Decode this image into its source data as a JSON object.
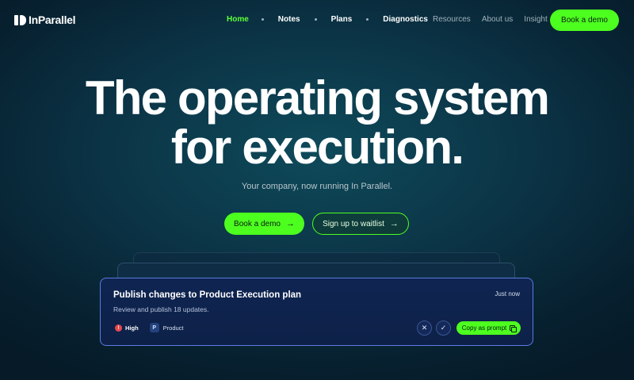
{
  "brand": {
    "name": "InParallel"
  },
  "nav": {
    "links": [
      "Home",
      "Notes",
      "Plans",
      "Diagnostics"
    ],
    "active": "Home",
    "secondary": [
      "Resources",
      "About us",
      "Insight"
    ],
    "cta_label": "Book a demo"
  },
  "hero": {
    "title_line1": "The operating system",
    "title_line2": "for execution.",
    "subtitle": "Your company, now running In Parallel.",
    "primary_cta": "Book a demo",
    "secondary_cta": "Sign up to waitlist",
    "cta_icon": "arrow-right-icon"
  },
  "card": {
    "title": "Publish changes to Product Execution plan",
    "description": "Review and publish 18 updates.",
    "time": "Just now",
    "priority_icon_glyph": "!",
    "priority_label": "High",
    "priority_color": "#e5484d",
    "category_glyph": "P",
    "category_label": "Product",
    "dismiss_glyph": "✕",
    "approve_glyph": "✓",
    "copy_label": "Copy as prompt"
  },
  "colors": {
    "accent": "#4dff1f",
    "background": "#0b3446",
    "card_border": "#5a7be0"
  }
}
